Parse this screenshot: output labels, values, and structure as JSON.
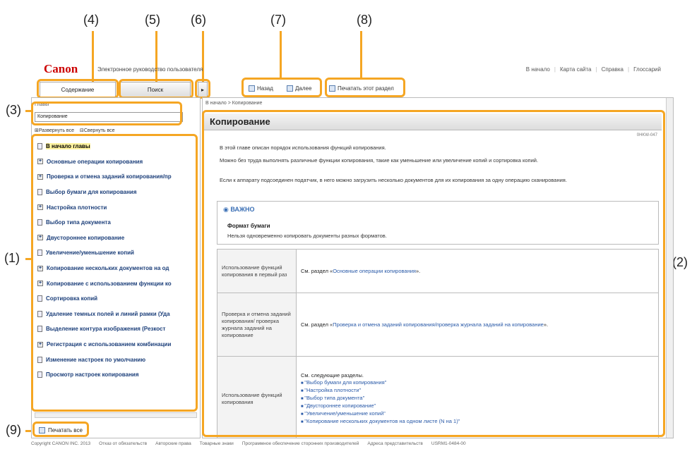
{
  "callouts": [
    "(4)",
    "(5)",
    "(6)",
    "(7)",
    "(8)",
    "(3)",
    "(1)",
    "(2)",
    "(9)"
  ],
  "header": {
    "logo": "Canon",
    "manual_title": "Электронное руководство пользователя",
    "links": [
      "В начало",
      "Карта сайта",
      "Справка",
      "Глоссарий"
    ]
  },
  "tabs": {
    "contents": "Содержание",
    "search": "Поиск",
    "toggle": "▸"
  },
  "toolbar": {
    "back": "Назад",
    "forward": "Далее",
    "print_section": "Печатать этот раздел"
  },
  "sidebar": {
    "chapter_label": "Главы",
    "chapter_select": "Копирование",
    "expand_all": "Развернуть все",
    "collapse_all": "Свернуть все",
    "chapters": [
      {
        "label": "В начало главы",
        "active": true,
        "expandable": false
      },
      {
        "label": "Основные операции копирования",
        "expandable": true
      },
      {
        "label": "Проверка и отмена заданий копирования/пр",
        "expandable": true
      },
      {
        "label": "Выбор бумаги для копирования",
        "expandable": false
      },
      {
        "label": "Настройка плотности",
        "expandable": true
      },
      {
        "label": "Выбор типа документа",
        "expandable": false
      },
      {
        "label": "Двустороннее копирование",
        "expandable": true
      },
      {
        "label": "Увеличение/уменьшение копий",
        "expandable": false
      },
      {
        "label": "Копирование нескольких документов на од",
        "expandable": true
      },
      {
        "label": "Копирование с использованием функции ко",
        "expandable": true
      },
      {
        "label": "Сортировка копий",
        "expandable": false
      },
      {
        "label": "Удаление темных полей и линий рамки (Уда",
        "expandable": false
      },
      {
        "label": "Выделение контура изображения (Резкост",
        "expandable": false
      },
      {
        "label": "Регистрация с использованием комбинации",
        "expandable": true
      },
      {
        "label": "Изменение настроек по умолчанию",
        "expandable": false
      },
      {
        "label": "Просмотр настроек копирования",
        "expandable": false
      }
    ],
    "print_all": "Печатать все"
  },
  "content": {
    "breadcrumb": "В начало > Копирование",
    "title": "Копирование",
    "doc_id": "0HKW-047",
    "paragraphs": [
      "В этой главе описан порядок использования функций копирования.",
      "Можно без труда выполнять различные функции копирования, такие как уменьшение или увеличение копий и сортировка копий.",
      "Если к аппарату подсоединен податчик, в него можно загрузить несколько документов для их копирования за одну операцию сканирования."
    ],
    "important": {
      "label": "ВАЖНО",
      "subtitle": "Формат бумаги",
      "text": "Нельзя одновременно копировать документы разных форматов."
    },
    "table": {
      "row1_col1": "Использование функций копирования в первый раз",
      "row1_prefix": "См. раздел «",
      "row1_link": "Основные операции копирования",
      "row1_suffix": "».",
      "row2_col1": "Проверка и отмена заданий копирования/ проверка журнала заданий на копирование",
      "row2_prefix": "См. раздел «",
      "row2_link": "Проверка и отмена заданий копирования/проверка журнала заданий на копирование",
      "row2_suffix": "».",
      "row3_col1": "Использование функций копирования",
      "row3_intro": "См. следующие разделы.",
      "row3_links": [
        "\"Выбор бумаги для копирования\"",
        "\"Настройка плотности\"",
        "\"Выбор типа документа\"",
        "\"Двустороннее копирование\"",
        "\"Увеличение/уменьшение копий\"",
        "\"Копирование нескольких документов на одном листе (N на 1)\""
      ]
    }
  },
  "footer": [
    "Copyright CANON INC. 2013",
    "Отказ от обязательств",
    "Авторские права",
    "Товарные знаки",
    "Программное обеспечение сторонних производителей",
    "Адреса представительств",
    "USRM1-0484-00"
  ],
  "colors": {
    "callout": "#f5a623",
    "brand": "#cc0000",
    "link": "#2a5aa8"
  }
}
